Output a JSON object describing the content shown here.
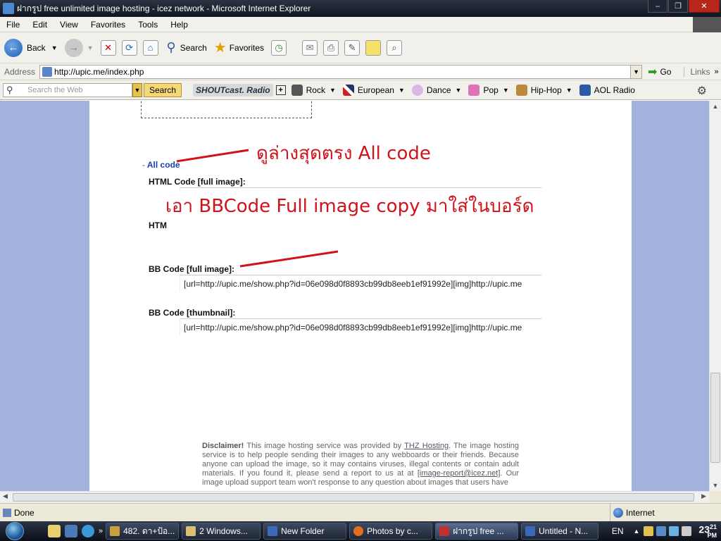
{
  "window": {
    "title": "ฝากรูป free unlimited image hosting - icez network - Microsoft Internet Explorer",
    "minimize": "‒",
    "maximize": "❐",
    "close": "✕"
  },
  "menu": [
    "File",
    "Edit",
    "View",
    "Favorites",
    "Tools",
    "Help"
  ],
  "toolbar": {
    "back": "Back",
    "search": "Search",
    "favorites": "Favorites"
  },
  "address": {
    "label": "Address",
    "url": "http://upic.me/index.php",
    "go": "Go",
    "links": "Links"
  },
  "searchbar": {
    "placeholder": "Search the Web",
    "button": "Search",
    "shoutcast": "SHOUTcast. Radio",
    "genres": [
      "Rock",
      "European",
      "Dance",
      "Pop",
      "Hip-Hop",
      "AOL Radio"
    ]
  },
  "page": {
    "all_code_prefix": "-",
    "all_code": "All code",
    "html_full_label": "HTML Code [full image]:",
    "html_thumb_label": "HTM",
    "bb_full_label": "BB Code [full image]:",
    "bb_full_value": "[url=http://upic.me/show.php?id=06e098d0f8893cb99db8eeb1ef91992e][img]http://upic.me",
    "bb_thumb_label": "BB Code [thumbnail]:",
    "bb_thumb_value": "[url=http://upic.me/show.php?id=06e098d0f8893cb99db8eeb1ef91992e][img]http://upic.me",
    "annotation_1": "ดูล่างสุดตรง All code",
    "annotation_2": "เอา BBCode Full image copy มาใส่ในบอร์ด",
    "disclaimer_title": "Disclaimer!",
    "disclaimer_1": "This image hosting service was provided by",
    "disclaimer_link": "THZ Hosting",
    "disclaimer_2": ". The image hosting service is to help people sending their images to any webboards or their friends. Because anyone can upload the image, so it may contains viruses, illegal contents or contain adult materials. If you found it, please send a report to us at at",
    "disclaimer_email": "[image-report@icez.net]",
    "disclaimer_3": ". Our image upload support team won't response to any question about images that users have"
  },
  "status": {
    "text": "Done",
    "zone": "Internet"
  },
  "taskbar": {
    "tasks": [
      "482. ดา+ป้อ...",
      "2 Windows...",
      "New Folder",
      "Photos by c...",
      "ฝากรูป free ...",
      "Untitled - N..."
    ],
    "language": "EN",
    "clock": "23",
    "clock_min": "21",
    "clock_suffix": "PM"
  },
  "colors": {
    "annotation": "#d0121a",
    "page_side": "#a4b3de",
    "link": "#1a3fb0"
  }
}
